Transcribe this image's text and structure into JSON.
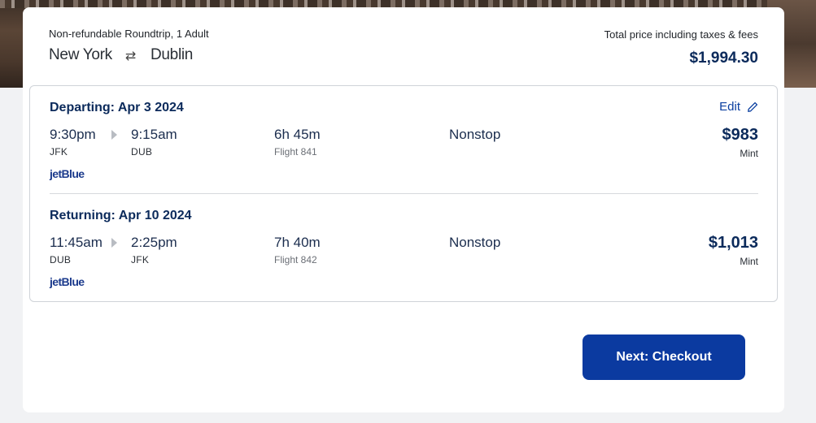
{
  "trip": {
    "type": "Non-refundable Roundtrip, 1 Adult",
    "origin": "New York",
    "destination": "Dublin",
    "swap_icon": "swap-arrows-icon"
  },
  "total": {
    "label": "Total price including taxes & fees",
    "price": "$1,994.30"
  },
  "legs": [
    {
      "title": "Departing: Apr 3 2024",
      "depart_time": "9:30pm",
      "depart_code": "JFK",
      "arrive_time": "9:15am",
      "arrive_code": "DUB",
      "duration": "6h 45m",
      "flight": "Flight 841",
      "stops": "Nonstop",
      "price": "$983",
      "cabin": "Mint",
      "airline": "jetBlue"
    },
    {
      "title": "Returning: Apr 10 2024",
      "depart_time": "11:45am",
      "depart_code": "DUB",
      "arrive_time": "2:25pm",
      "arrive_code": "JFK",
      "duration": "7h 40m",
      "flight": "Flight 842",
      "stops": "Nonstop",
      "price": "$1,013",
      "cabin": "Mint",
      "airline": "jetBlue"
    }
  ],
  "edit": {
    "label": "Edit",
    "icon": "pencil-icon"
  },
  "actions": {
    "checkout_label": "Next: Checkout"
  },
  "colors": {
    "brand": "#0b3aa0",
    "heading": "#0b2a5b"
  }
}
